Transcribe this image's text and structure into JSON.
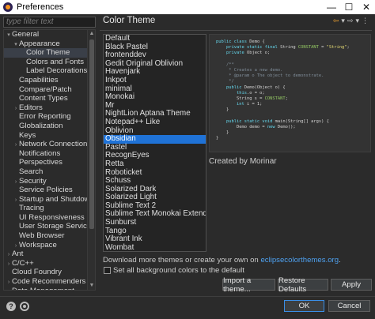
{
  "window": {
    "title": "Preferences",
    "minimize_glyph": "—",
    "maximize_glyph": "☐",
    "close_glyph": "✕"
  },
  "filter": {
    "placeholder": "type filter text"
  },
  "tree": [
    {
      "label": "General",
      "expander": "▾",
      "depth": 0
    },
    {
      "label": "Appearance",
      "expander": "▾",
      "depth": 1
    },
    {
      "label": "Color Theme",
      "expander": "",
      "depth": 2,
      "selected": true
    },
    {
      "label": "Colors and Fonts",
      "expander": "",
      "depth": 2
    },
    {
      "label": "Label Decorations",
      "expander": "",
      "depth": 2
    },
    {
      "label": "Capabilities",
      "expander": "",
      "depth": 1
    },
    {
      "label": "Compare/Patch",
      "expander": "",
      "depth": 1
    },
    {
      "label": "Content Types",
      "expander": "",
      "depth": 1
    },
    {
      "label": "Editors",
      "expander": "›",
      "depth": 1
    },
    {
      "label": "Error Reporting",
      "expander": "",
      "depth": 1
    },
    {
      "label": "Globalization",
      "expander": "",
      "depth": 1
    },
    {
      "label": "Keys",
      "expander": "",
      "depth": 1
    },
    {
      "label": "Network Connections",
      "expander": "›",
      "depth": 1
    },
    {
      "label": "Notifications",
      "expander": "",
      "depth": 1
    },
    {
      "label": "Perspectives",
      "expander": "",
      "depth": 1
    },
    {
      "label": "Search",
      "expander": "",
      "depth": 1
    },
    {
      "label": "Security",
      "expander": "›",
      "depth": 1
    },
    {
      "label": "Service Policies",
      "expander": "",
      "depth": 1
    },
    {
      "label": "Startup and Shutdown",
      "expander": "›",
      "depth": 1
    },
    {
      "label": "Tracing",
      "expander": "",
      "depth": 1
    },
    {
      "label": "UI Responsiveness Mon",
      "expander": "",
      "depth": 1
    },
    {
      "label": "User Storage Service",
      "expander": "",
      "depth": 1
    },
    {
      "label": "Web Browser",
      "expander": "",
      "depth": 1
    },
    {
      "label": "Workspace",
      "expander": "›",
      "depth": 1
    },
    {
      "label": "Ant",
      "expander": "›",
      "depth": 0
    },
    {
      "label": "C/C++",
      "expander": "›",
      "depth": 0
    },
    {
      "label": "Cloud Foundry",
      "expander": "",
      "depth": 0
    },
    {
      "label": "Code Recommenders",
      "expander": "›",
      "depth": 0
    },
    {
      "label": "Data Management",
      "expander": "›",
      "depth": 0
    }
  ],
  "panel": {
    "title": "Color Theme",
    "nav_back": "⇦",
    "nav_back_menu": "▾",
    "nav_forward": "⇨",
    "nav_forward_menu": "▾",
    "nav_menu": "⋮"
  },
  "themes": [
    "Default",
    "Black Pastel",
    "frontenddev",
    "Gedit Original Oblivion",
    "Havenjark",
    "Inkpot",
    "minimal",
    "Monokai",
    "Mr",
    "NightLion Aptana Theme",
    "Notepad++ Like",
    "Oblivion",
    "Obsidian",
    "Pastel",
    "RecognEyes",
    "Retta",
    "Roboticket",
    "Schuss",
    "Solarized Dark",
    "Solarized Light",
    "Sublime Text 2",
    "Sublime Text Monokai Extended",
    "Sunburst",
    "Tango",
    "Vibrant Ink",
    "Wombat",
    "Zenburn"
  ],
  "selected_theme": "Obsidian",
  "preview": {
    "lines": [
      [
        {
          "t": "public class ",
          "c": "kw"
        },
        {
          "t": "Demo ",
          "c": "id"
        },
        {
          "t": "{",
          "c": "id"
        }
      ],
      [
        {
          "t": "    private static final ",
          "c": "kw"
        },
        {
          "t": "String ",
          "c": "id"
        },
        {
          "t": "CONSTANT",
          "c": "cn"
        },
        {
          "t": " = ",
          "c": "id"
        },
        {
          "t": "\"String\"",
          "c": "str"
        },
        {
          "t": ";",
          "c": "id"
        }
      ],
      [
        {
          "t": "    private ",
          "c": "kw"
        },
        {
          "t": "Object o;",
          "c": "id"
        }
      ],
      [],
      [
        {
          "t": "    /**",
          "c": "cm"
        }
      ],
      [
        {
          "t": "     * Creates a new demo.",
          "c": "cm"
        }
      ],
      [
        {
          "t": "     * @param o The object to demonstrate.",
          "c": "cm"
        }
      ],
      [
        {
          "t": "     */",
          "c": "cm"
        }
      ],
      [
        {
          "t": "    public ",
          "c": "kw"
        },
        {
          "t": "Demo(Object o) {",
          "c": "id"
        }
      ],
      [
        {
          "t": "        this",
          "c": "kw"
        },
        {
          "t": ".o = o;",
          "c": "id"
        }
      ],
      [
        {
          "t": "        String s = ",
          "c": "id"
        },
        {
          "t": "CONSTANT",
          "c": "cn"
        },
        {
          "t": ";",
          "c": "id"
        }
      ],
      [
        {
          "t": "        int ",
          "c": "kw"
        },
        {
          "t": "i = 1;",
          "c": "id"
        }
      ],
      [
        {
          "t": "    }",
          "c": "id"
        }
      ],
      [],
      [
        {
          "t": "    public static void ",
          "c": "kw"
        },
        {
          "t": "main(String[] args) {",
          "c": "id"
        }
      ],
      [
        {
          "t": "        Demo demo = ",
          "c": "id"
        },
        {
          "t": "new ",
          "c": "kw"
        },
        {
          "t": "Demo();",
          "c": "id"
        }
      ],
      [
        {
          "t": "    }",
          "c": "id"
        }
      ],
      [
        {
          "t": "}",
          "c": "id"
        }
      ]
    ],
    "created_by": "Created by Morinar"
  },
  "download": {
    "prefix": "Download more themes or create your own on ",
    "link": "eclipsecolorthemes.org",
    "suffix": "."
  },
  "checkbox": {
    "label": "Set all background colors to the default",
    "checked": false
  },
  "buttons": {
    "import": "Import a theme...",
    "restore": "Restore Defaults",
    "apply": "Apply",
    "ok": "OK",
    "cancel": "Cancel"
  },
  "colors": {
    "selection": "#1f72d6",
    "link": "#4ea1f0",
    "background": "#2b2b2b",
    "code_keyword": "#66d9ef",
    "code_string": "#e6db74",
    "code_comment": "#7f8c98",
    "code_constant": "#93c763"
  }
}
